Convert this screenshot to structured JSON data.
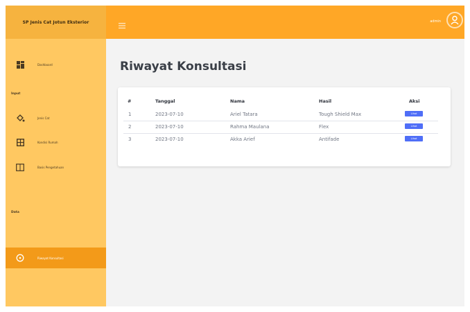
{
  "brand": {
    "title": "SP Jenis Cat Jotun Eksterior"
  },
  "sidebar": {
    "dashboard": "Dashboard",
    "section_input": "Input",
    "items_input": [
      "Jenis Cat",
      "Kondisi Rumah",
      "Basis Pengetahuan"
    ],
    "section_data": "Data",
    "items_data": [
      "Riwayat Konsultasi"
    ]
  },
  "topbar": {
    "user": "admin"
  },
  "main": {
    "title": "Riwayat Konsultasi",
    "columns": [
      "#",
      "Tanggal",
      "Nama",
      "Hasil",
      "Aksi"
    ],
    "rows": [
      [
        "1",
        "2023-07-10",
        "Ariel Tatara",
        "Tough Shield Max",
        "Lihat"
      ],
      [
        "2",
        "2023-07-10",
        "Rahma Maulana",
        "Flex",
        "Lihat"
      ],
      [
        "3",
        "2023-07-10",
        "Akka Arief",
        "Antifade",
        "Lihat"
      ]
    ]
  },
  "colors": {
    "sidebar": "#ffc861",
    "brand_bar": "#f6b33f",
    "topbar": "#ffa726",
    "active": "#f39a19",
    "button": "#4f6ef7"
  },
  "icons": {
    "dashboard": "dashboard-icon",
    "jenis_cat": "paint-bucket-icon",
    "kondisi": "house-grid-icon",
    "basis": "book-icon",
    "riwayat": "history-icon",
    "menu": "hamburger-icon",
    "user": "user-icon"
  }
}
